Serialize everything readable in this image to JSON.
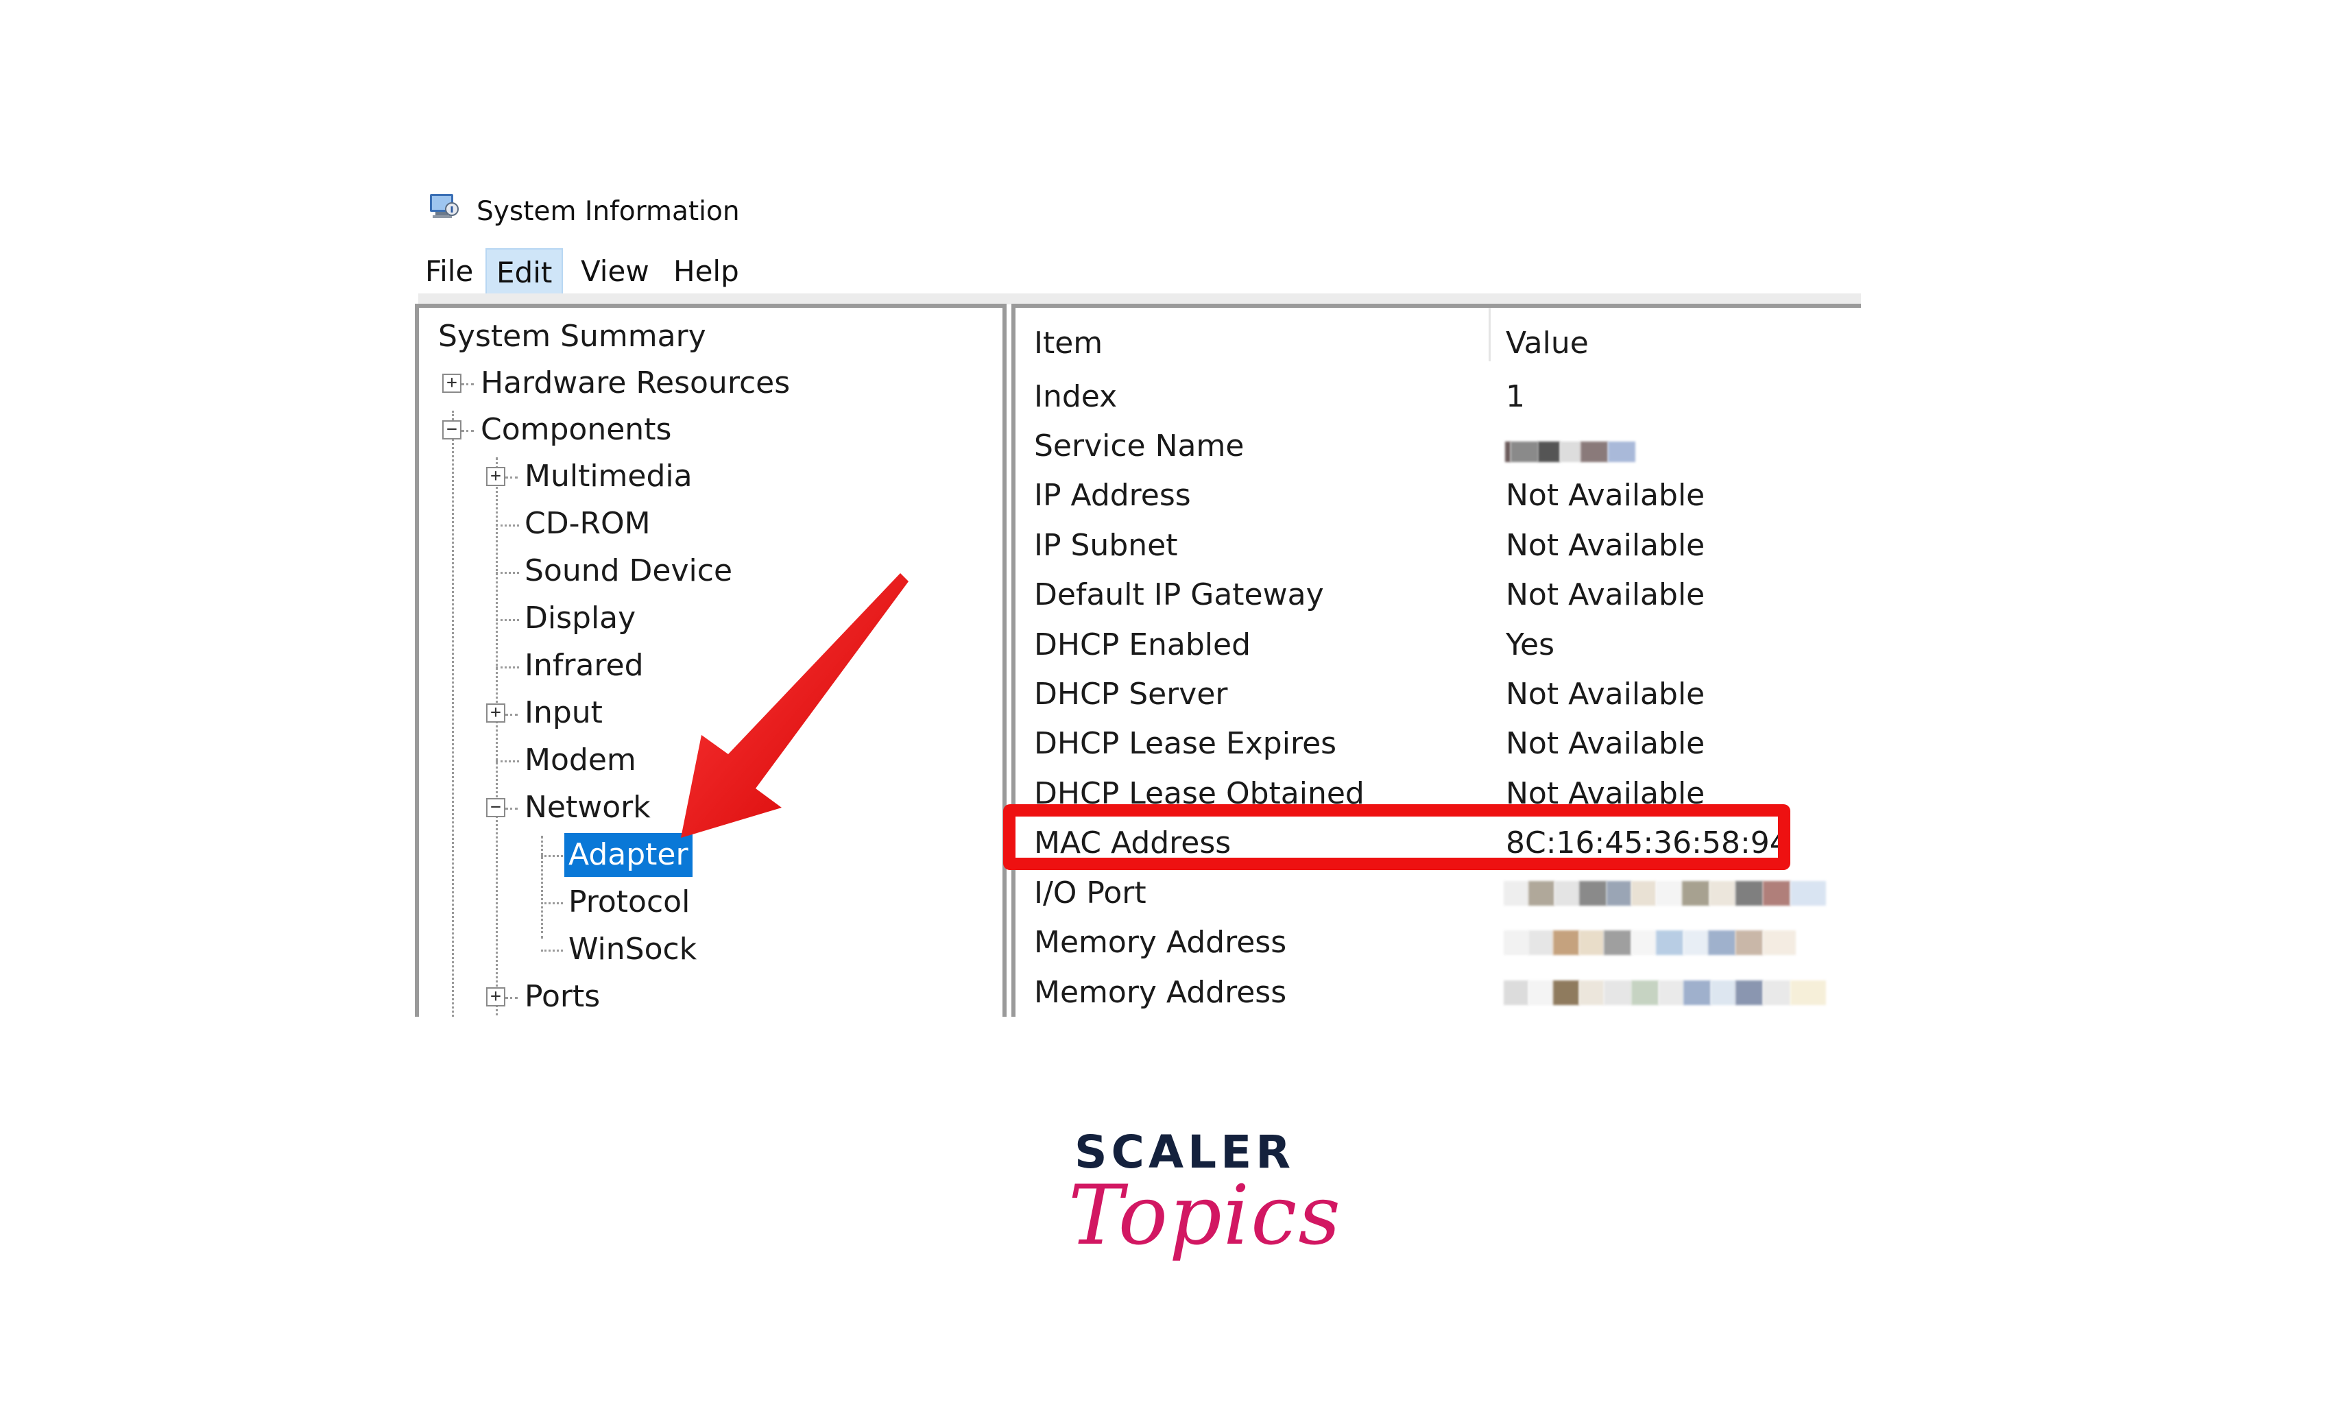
{
  "window": {
    "title": "System Information",
    "icon": "system-information-icon"
  },
  "menu": {
    "items": [
      "File",
      "Edit",
      "View",
      "Help"
    ],
    "active": "Edit"
  },
  "tree": {
    "items": [
      {
        "label": "System Summary"
      },
      {
        "label": "Hardware Resources",
        "expander": "+"
      },
      {
        "label": "Components",
        "expander": "−"
      },
      {
        "label": "Multimedia",
        "expander": "+"
      },
      {
        "label": "CD-ROM"
      },
      {
        "label": "Sound Device"
      },
      {
        "label": "Display"
      },
      {
        "label": "Infrared"
      },
      {
        "label": "Input",
        "expander": "+"
      },
      {
        "label": "Modem"
      },
      {
        "label": "Network",
        "expander": "−"
      },
      {
        "label": "Adapter",
        "selected": true
      },
      {
        "label": "Protocol"
      },
      {
        "label": "WinSock"
      },
      {
        "label": "Ports",
        "expander": "+"
      }
    ]
  },
  "details": {
    "columns": {
      "item": "Item",
      "value": "Value"
    },
    "rows": [
      {
        "item": "Index",
        "value": "1"
      },
      {
        "item": "Service Name",
        "value": "",
        "redacted": true
      },
      {
        "item": "IP Address",
        "value": "Not Available"
      },
      {
        "item": "IP Subnet",
        "value": "Not Available"
      },
      {
        "item": "Default IP Gateway",
        "value": "Not Available"
      },
      {
        "item": "DHCP Enabled",
        "value": "Yes"
      },
      {
        "item": "DHCP Server",
        "value": "Not Available"
      },
      {
        "item": "DHCP Lease Expires",
        "value": "Not Available"
      },
      {
        "item": "DHCP Lease Obtained",
        "value": "Not Available"
      },
      {
        "item": "MAC Address",
        "value": "8C:16:45:36:58:94",
        "highlighted": true
      },
      {
        "item": "I/O Port",
        "value": "",
        "redacted": true
      },
      {
        "item": "Memory Address",
        "value": "",
        "redacted": true
      },
      {
        "item": "Memory Address",
        "value": "",
        "redacted": true
      }
    ]
  },
  "annotation": {
    "highlight_color": "#ee1111",
    "arrow_color": "#ee1111"
  },
  "brand": {
    "line1": "SCALER",
    "line2": "Topics",
    "colors": {
      "line1": "#14213d",
      "line2": "#d21762"
    }
  }
}
